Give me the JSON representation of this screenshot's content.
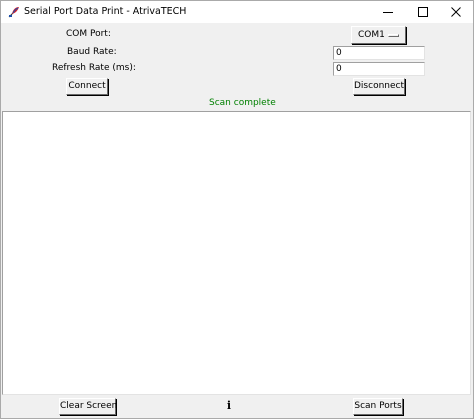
{
  "window": {
    "title": "Serial Port Data Print - AtrivaTECH",
    "icon": "tk-feather-icon",
    "controls": {
      "minimize": "minimize-icon",
      "maximize": "maximize-icon",
      "close": "close-icon"
    }
  },
  "form": {
    "com_port_label": "COM Port:",
    "com_port_value": "COM1",
    "baud_rate_label": "Baud Rate:",
    "baud_rate_value": "0",
    "refresh_rate_label": "Refresh Rate (ms):",
    "refresh_rate_value": "0",
    "connect_label": "Connect",
    "disconnect_label": "Disconnect"
  },
  "status": {
    "text": "Scan complete",
    "color": "#008000"
  },
  "output": {
    "text": ""
  },
  "bottom": {
    "clear_label": "Clear Screen",
    "info_glyph": "i",
    "scan_label": "Scan Ports"
  }
}
